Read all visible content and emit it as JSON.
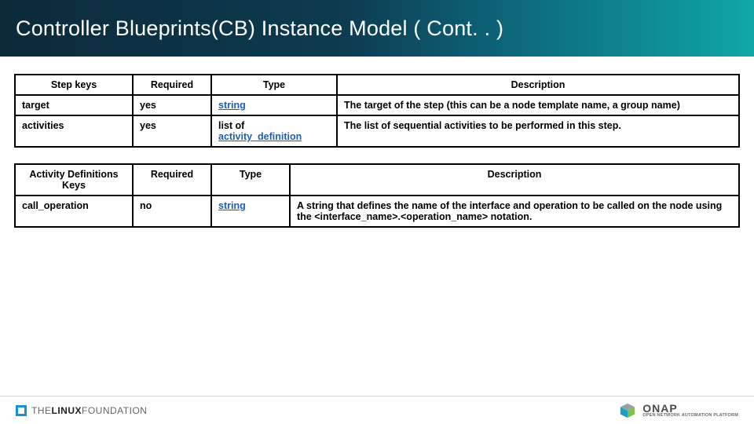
{
  "header": {
    "title": "Controller Blueprints(CB) Instance Model ( Cont. . )"
  },
  "table1": {
    "headers": {
      "c1": "Step keys",
      "c2": "Required",
      "c3": "Type",
      "c4": "Description"
    },
    "rows": [
      {
        "key": "target",
        "required": "yes",
        "type_text": "string",
        "type_link": "string",
        "desc": "The target of the step (this can be a node template name, a group name)"
      },
      {
        "key": "activities",
        "required": "yes",
        "type_prefix": "list of ",
        "type_link": "activity_definition",
        "desc": "The list of sequential activities to be performed in this step."
      }
    ]
  },
  "table2": {
    "headers": {
      "c1": "Activity Definitions Keys",
      "c2": "Required",
      "c3": "Type",
      "c4": "Description"
    },
    "rows": [
      {
        "key": "call_operation",
        "required": "no",
        "type_link": "string",
        "desc": "A string that defines the name of the interface and operation to be called on the node using the <interface_name>.<operation_name> notation."
      }
    ]
  },
  "footer": {
    "lf_prefix": "THE",
    "lf_mid": "LINUX",
    "lf_suffix": "FOUNDATION",
    "onap_big": "ONAP",
    "onap_small": "OPEN NETWORK AUTOMATION PLATFORM"
  }
}
